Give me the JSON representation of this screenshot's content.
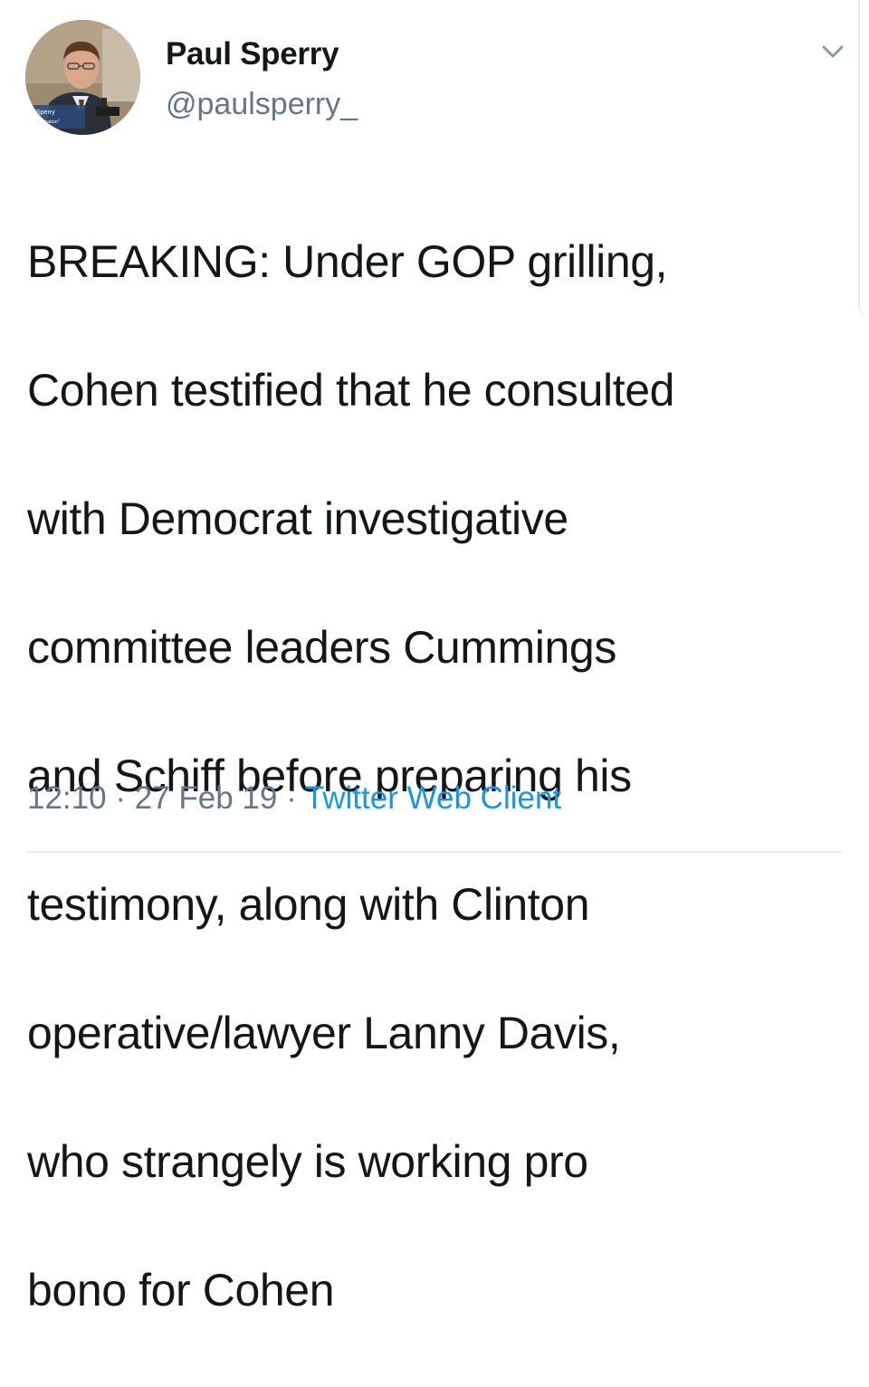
{
  "tweet": {
    "author": {
      "display_name": "Paul Sperry",
      "handle": "@paulsperry_"
    },
    "avatar_overlay": {
      "line1": "Sperry",
      "line2": "\"Infiltration\""
    },
    "text_lines": [
      "BREAKING: Under GOP grilling,",
      "Cohen testified that he consulted",
      "with Democrat investigative",
      "committee leaders Cummings",
      "and Schiff before preparing his",
      "testimony, along with Clinton",
      "operative/lawyer Lanny Davis,",
      "who strangely is working pro",
      "bono for Cohen"
    ],
    "time": "12:10",
    "date": "27 Feb 19",
    "separator": "·",
    "source": "Twitter Web Client"
  },
  "icons": {
    "menu_caret": "chevron-down-icon",
    "avatar": "profile-photo"
  },
  "colors": {
    "text": "#14171a",
    "secondary": "#657786",
    "link": "#1b95e0",
    "divider": "#e6ecf0"
  }
}
